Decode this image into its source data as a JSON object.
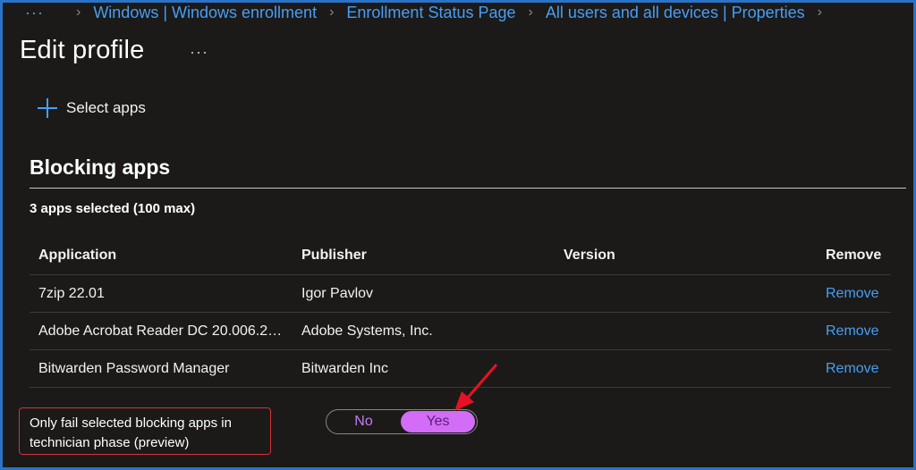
{
  "breadcrumb": {
    "items": [
      "Windows | Windows enrollment",
      "Enrollment Status Page",
      "All users and all devices | Properties"
    ]
  },
  "page": {
    "title": "Edit profile"
  },
  "actions": {
    "select_apps": "Select apps"
  },
  "section": {
    "title": "Blocking apps",
    "count_label": "3 apps selected (100 max)"
  },
  "table": {
    "headers": [
      "Application",
      "Publisher",
      "Version",
      "Remove"
    ],
    "rows": [
      {
        "application": "7zip 22.01",
        "publisher": "Igor Pavlov",
        "version": "",
        "remove": "Remove"
      },
      {
        "application": "Adobe Acrobat Reader DC 20.006.2…",
        "publisher": "Adobe Systems, Inc.",
        "version": "",
        "remove": "Remove"
      },
      {
        "application": "Bitwarden Password Manager",
        "publisher": "Bitwarden Inc",
        "version": "",
        "remove": "Remove"
      }
    ]
  },
  "setting": {
    "label": "Only fail selected blocking apps in technician phase (preview)",
    "options": [
      "No",
      "Yes"
    ],
    "selected": "Yes"
  },
  "colors": {
    "accent": "#479ef5",
    "toggle_selected": "#d36cf7",
    "highlight_border": "#d13438",
    "frame_border": "#2a73c7"
  },
  "icons": {
    "more": "ellipsis-icon",
    "breadcrumb_sep": "chevron-right-icon",
    "add": "plus-icon",
    "annotation": "red-arrow-icon"
  }
}
